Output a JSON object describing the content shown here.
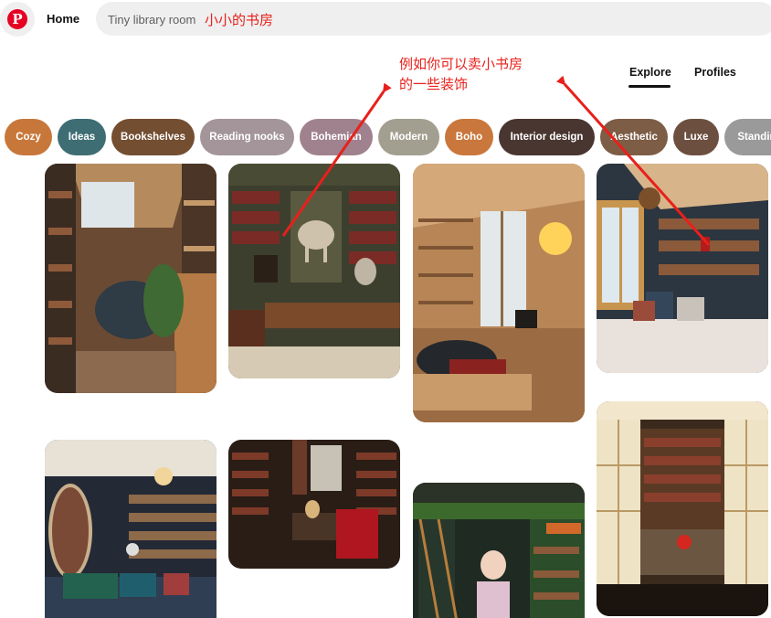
{
  "header": {
    "logo_letter": "P",
    "home_label": "Home",
    "search": {
      "value": "Tiny library room",
      "annotation": "小小的书房"
    }
  },
  "annotation": {
    "line1": "例如你可以卖小书房",
    "line2": "的一些装饰",
    "color": "#e8201b"
  },
  "tabs": [
    {
      "label": "Explore",
      "active": true
    },
    {
      "label": "Profiles",
      "active": false
    }
  ],
  "chips": [
    {
      "label": "Cozy",
      "color": "#c8773a"
    },
    {
      "label": "Ideas",
      "color": "#3e6d73"
    },
    {
      "label": "Bookshelves",
      "color": "#734e31"
    },
    {
      "label": "Reading nooks",
      "color": "#a39599"
    },
    {
      "label": "Bohemian",
      "color": "#a0828f"
    },
    {
      "label": "Modern",
      "color": "#a29e90"
    },
    {
      "label": "Boho",
      "color": "#c9773c"
    },
    {
      "label": "Interior design",
      "color": "#4a3631"
    },
    {
      "label": "Aesthetic",
      "color": "#7d5d45"
    },
    {
      "label": "Luxe",
      "color": "#6d4f40"
    },
    {
      "label": "Standing",
      "color": "#9a9a9a"
    }
  ],
  "pins": [
    {
      "name": "attic-library-nook"
    },
    {
      "name": "classic-study-with-horse-statue"
    },
    {
      "name": "wooden-cabin-reading-room"
    },
    {
      "name": "attic-window-seat-nook"
    },
    {
      "name": "navy-library-with-leather-sofa"
    },
    {
      "name": "dark-library-red-armchair"
    },
    {
      "name": "green-shelves-with-ladder"
    },
    {
      "name": "french-doors-library"
    }
  ]
}
